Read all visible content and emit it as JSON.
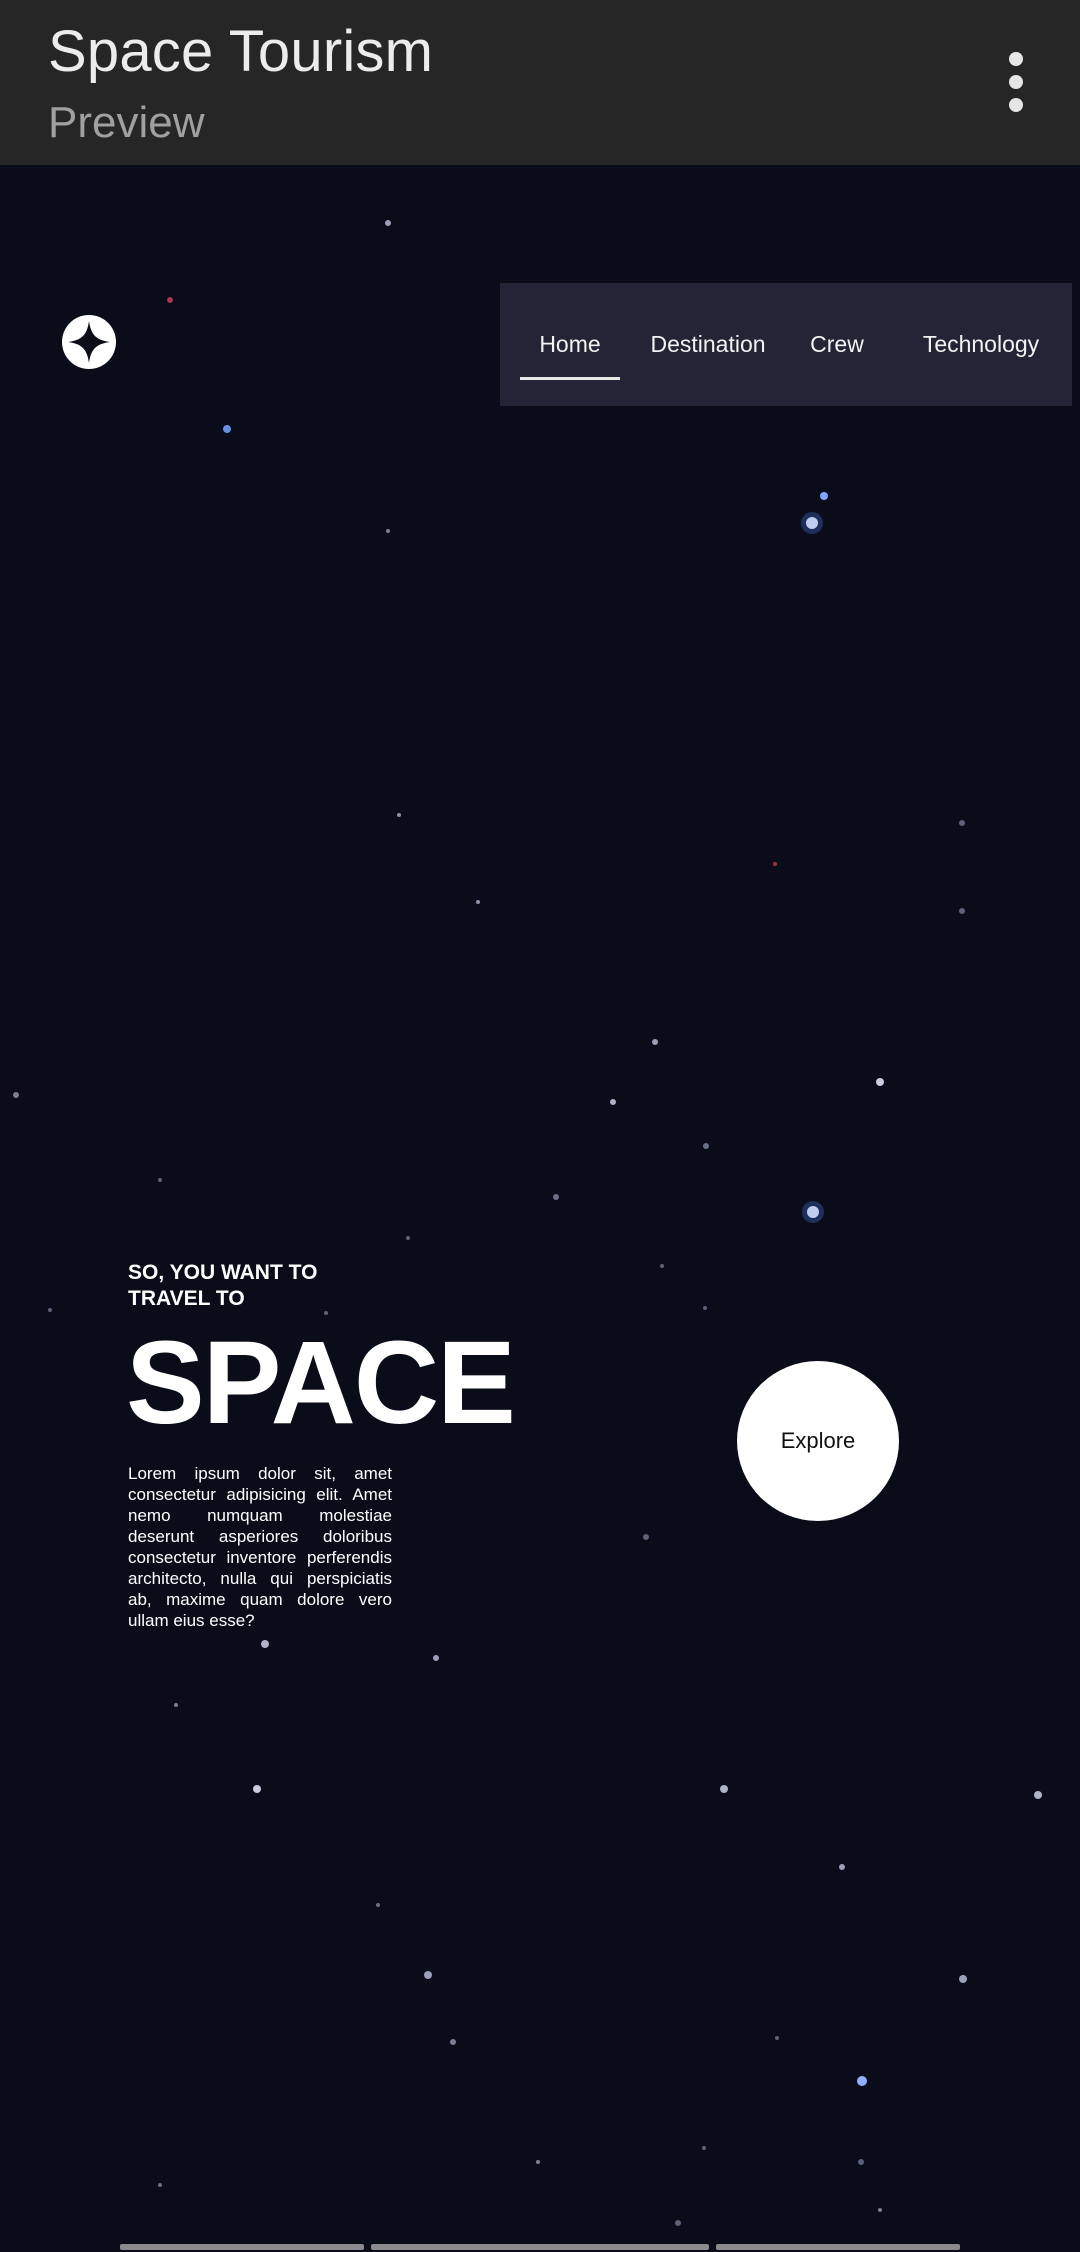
{
  "app": {
    "title": "Space Tourism",
    "subtitle": "Preview",
    "menu_icon": "more-vertical-icon"
  },
  "site": {
    "logo_icon": "four-point-star-icon",
    "nav": [
      {
        "label": "Home",
        "active": true
      },
      {
        "label": "Destination",
        "active": false
      },
      {
        "label": "Crew",
        "active": false
      },
      {
        "label": "Technology",
        "active": false
      }
    ]
  },
  "hero": {
    "kicker_line1": "SO, YOU WANT TO",
    "kicker_line2": "TRAVEL TO",
    "headline": "SPACE",
    "body": "Lorem ipsum dolor sit, amet consectetur adipisicing elit. Amet nemo numquam molestiae deserunt asperiores doloribus consectetur inventore perferendis architecto, nulla qui perspiciatis ab, maxime quam dolore vero ullam eius esse?",
    "button_label": "Explore"
  },
  "colors": {
    "appbar": "#262626",
    "background": "#0a0c1a",
    "nav_background": "#262838",
    "text": "#ffffff"
  }
}
